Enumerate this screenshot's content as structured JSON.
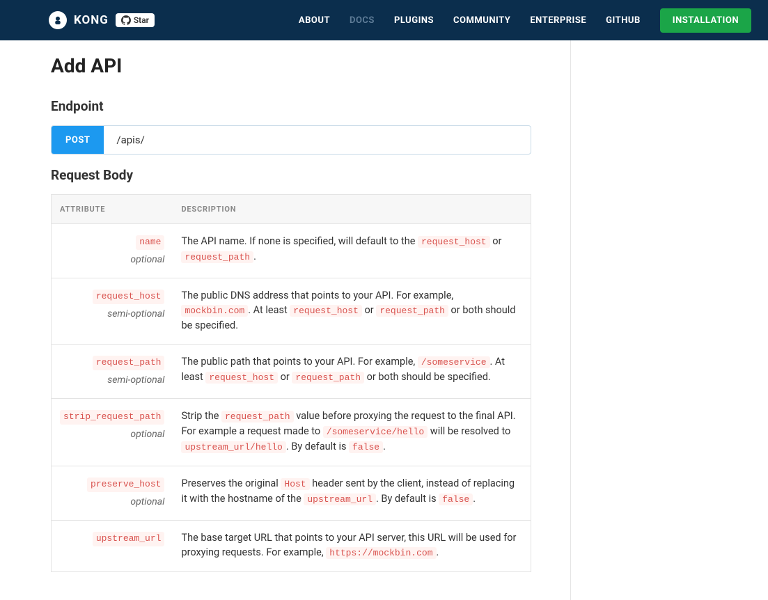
{
  "header": {
    "brand": "KONG",
    "github_star": "Star",
    "nav": {
      "about": "ABOUT",
      "docs": "DOCS",
      "plugins": "PLUGINS",
      "community": "COMMUNITY",
      "enterprise": "ENTERPRISE",
      "github": "GITHUB"
    },
    "install_btn": "INSTALLATION"
  },
  "page": {
    "title": "Add API",
    "endpoint_heading": "Endpoint",
    "method": "POST",
    "path": "/apis/",
    "body_heading": "Request Body",
    "table_head": {
      "attr": "ATTRIBUTE",
      "desc": "DESCRIPTION"
    },
    "rows": [
      {
        "name": "name",
        "note": "optional",
        "desc_parts": [
          "The API name. If none is specified, will default to the ",
          "request_host",
          " or ",
          "request_path",
          "."
        ]
      },
      {
        "name": "request_host",
        "note": "semi-optional",
        "desc_parts": [
          "The public DNS address that points to your API. For example, ",
          "mockbin.com",
          ". At least ",
          "request_host",
          " or ",
          "request_path",
          " or both should be specified."
        ]
      },
      {
        "name": "request_path",
        "note": "semi-optional",
        "desc_parts": [
          "The public path that points to your API. For example, ",
          "/someservice",
          ". At least ",
          "request_host",
          " or ",
          "request_path",
          " or both should be specified."
        ]
      },
      {
        "name": "strip_request_path",
        "note": "optional",
        "desc_parts": [
          "Strip the ",
          "request_path",
          " value before proxying the request to the final API. For example a request made to ",
          "/someservice/hello",
          " will be resolved to ",
          "upstream_url/hello",
          ". By default is ",
          "false",
          "."
        ]
      },
      {
        "name": "preserve_host",
        "note": "optional",
        "desc_parts": [
          "Preserves the original ",
          "Host",
          " header sent by the client, instead of replacing it with the hostname of the ",
          "upstream_url",
          ". By default is ",
          "false",
          "."
        ]
      },
      {
        "name": "upstream_url",
        "note": "",
        "desc_parts": [
          "The base target URL that points to your API server, this URL will be used for proxying requests. For example, ",
          "https://mockbin.com",
          "."
        ]
      }
    ]
  }
}
